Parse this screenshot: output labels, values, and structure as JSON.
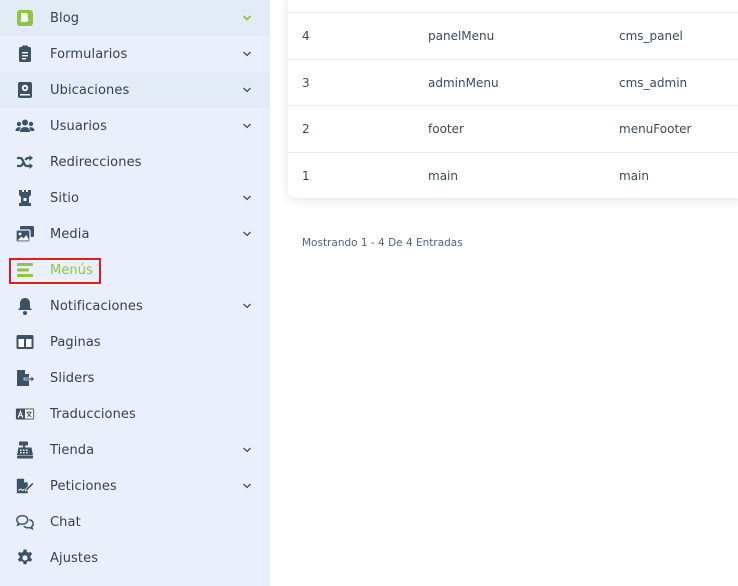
{
  "sidebar": {
    "items": [
      {
        "label": "Blog",
        "icon": "blog-icon",
        "chevron": true
      },
      {
        "label": "Formularios",
        "icon": "clipboard-icon",
        "chevron": true
      },
      {
        "label": "Ubicaciones",
        "icon": "map-book-icon",
        "chevron": true
      },
      {
        "label": "Usuarios",
        "icon": "users-icon",
        "chevron": true
      },
      {
        "label": "Redirecciones",
        "icon": "shuffle-icon",
        "chevron": false
      },
      {
        "label": "Sitio",
        "icon": "tower-icon",
        "chevron": true
      },
      {
        "label": "Media",
        "icon": "images-icon",
        "chevron": true
      },
      {
        "label": "Menús",
        "icon": "menu-bars-icon",
        "chevron": false,
        "active": true
      },
      {
        "label": "Notificaciones",
        "icon": "bell-icon",
        "chevron": true
      },
      {
        "label": "Paginas",
        "icon": "columns-icon",
        "chevron": false
      },
      {
        "label": "Sliders",
        "icon": "file-export-icon",
        "chevron": false
      },
      {
        "label": "Traducciones",
        "icon": "language-icon",
        "chevron": false
      },
      {
        "label": "Tienda",
        "icon": "cash-register-icon",
        "chevron": true
      },
      {
        "label": "Peticiones",
        "icon": "file-signature-icon",
        "chevron": true
      },
      {
        "label": "Chat",
        "icon": "comments-icon",
        "chevron": false
      },
      {
        "label": "Ajustes",
        "icon": "cog-icon",
        "chevron": false
      }
    ]
  },
  "table": {
    "rows": [
      {
        "id": "4",
        "name": "panelMenu",
        "key": "cms_panel"
      },
      {
        "id": "3",
        "name": "adminMenu",
        "key": "cms_admin"
      },
      {
        "id": "2",
        "name": "footer",
        "key": "menuFooter"
      },
      {
        "id": "1",
        "name": "main",
        "key": "main"
      }
    ]
  },
  "pagination": {
    "summary": "Mostrando 1 - 4 De 4 Entradas"
  },
  "colors": {
    "accent": "#8dc63f",
    "sidebar_bg": "#e9f0fb",
    "icon": "#3e5266",
    "active_outline": "#e01b1b"
  }
}
